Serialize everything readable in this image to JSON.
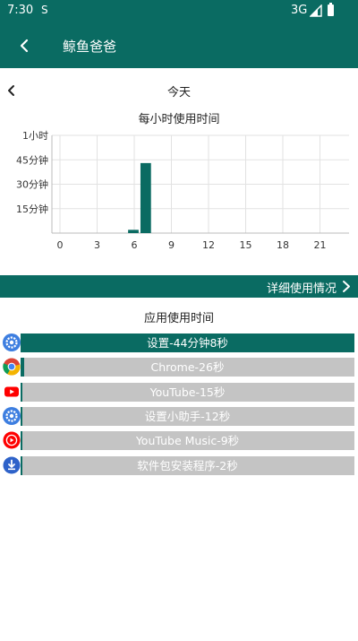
{
  "status_bar": {
    "time": "7:30",
    "notif_icon": "S",
    "network": "3G"
  },
  "app_bar": {
    "title": "鲸鱼爸爸",
    "back_icon": "arrow-back-icon"
  },
  "day_nav": {
    "label": "今天",
    "prev_icon": "chevron-left-icon"
  },
  "chart_title": "每小时使用时间",
  "chart_data": {
    "type": "bar",
    "title": "每小时使用时间",
    "x": [
      0,
      1,
      2,
      3,
      4,
      5,
      6,
      7,
      8,
      9,
      10,
      11,
      12,
      13,
      14,
      15,
      16,
      17,
      18,
      19,
      20,
      21,
      22,
      23
    ],
    "values": [
      0,
      0,
      0,
      0,
      0,
      0,
      2,
      43,
      0,
      0,
      0,
      0,
      0,
      0,
      0,
      0,
      0,
      0,
      0,
      0,
      0,
      0,
      0,
      0
    ],
    "xticks": [
      "0",
      "3",
      "6",
      "9",
      "12",
      "15",
      "18",
      "21"
    ],
    "yticks": [
      "15分钟",
      "30分钟",
      "45分钟",
      "1小时"
    ],
    "ylim": [
      0,
      60
    ],
    "unit": "minutes",
    "bar_color": "#0a6b62",
    "grid": true
  },
  "detail_bar": {
    "label": "详细使用情况",
    "arrow_icon": "chevron-right-icon"
  },
  "apps_title": "应用使用时间",
  "apps": [
    {
      "label": "设置-44分钟8秒",
      "seconds": 2648,
      "icon": "settings-gear-icon"
    },
    {
      "label": "Chrome-26秒",
      "seconds": 26,
      "icon": "chrome-icon"
    },
    {
      "label": "YouTube-15秒",
      "seconds": 15,
      "icon": "youtube-icon"
    },
    {
      "label": "设置小助手-12秒",
      "seconds": 12,
      "icon": "settings-gear-icon"
    },
    {
      "label": "YouTube Music-9秒",
      "seconds": 9,
      "icon": "youtube-music-icon"
    },
    {
      "label": "软件包安装程序-2秒",
      "seconds": 2,
      "icon": "package-installer-icon"
    }
  ],
  "colors": {
    "primary": "#0a6b62",
    "bar_bg": "#c4c4c4"
  }
}
